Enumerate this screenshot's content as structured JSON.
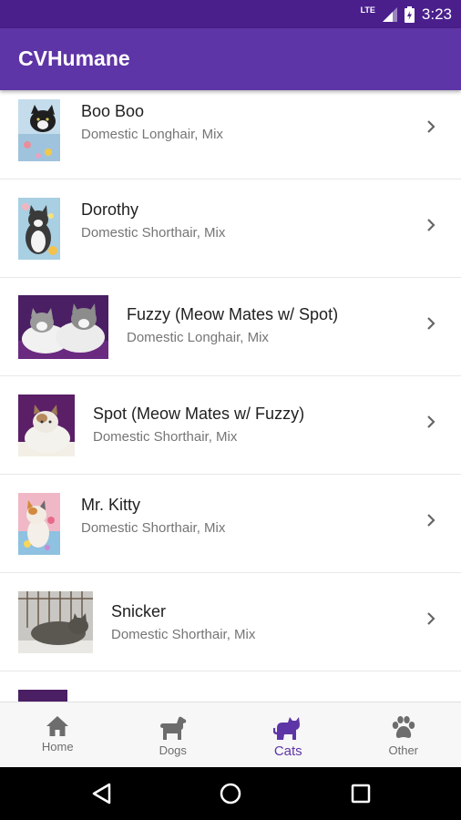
{
  "status_bar": {
    "network": "LTE",
    "time": "3:23"
  },
  "app": {
    "title": "CVHumane"
  },
  "pets": [
    {
      "name": "Boo Boo",
      "breed": "Domestic Longhair, Mix"
    },
    {
      "name": "Dorothy",
      "breed": "Domestic Shorthair, Mix"
    },
    {
      "name": "Fuzzy (Meow Mates w/ Spot)",
      "breed": "Domestic Longhair, Mix"
    },
    {
      "name": "Spot (Meow Mates w/ Fuzzy)",
      "breed": "Domestic Shorthair, Mix"
    },
    {
      "name": "Mr. Kitty",
      "breed": "Domestic Shorthair, Mix"
    },
    {
      "name": "Snicker",
      "breed": "Domestic Shorthair, Mix"
    }
  ],
  "bottom_nav": {
    "items": [
      {
        "label": "Home",
        "icon": "home-icon"
      },
      {
        "label": "Dogs",
        "icon": "dog-icon"
      },
      {
        "label": "Cats",
        "icon": "cat-icon"
      },
      {
        "label": "Other",
        "icon": "paw-icon"
      }
    ],
    "active": "Cats"
  },
  "colors": {
    "primary": "#5e35a6",
    "status_bar": "#4a1f8c",
    "active_tab": "#5e35a6"
  }
}
